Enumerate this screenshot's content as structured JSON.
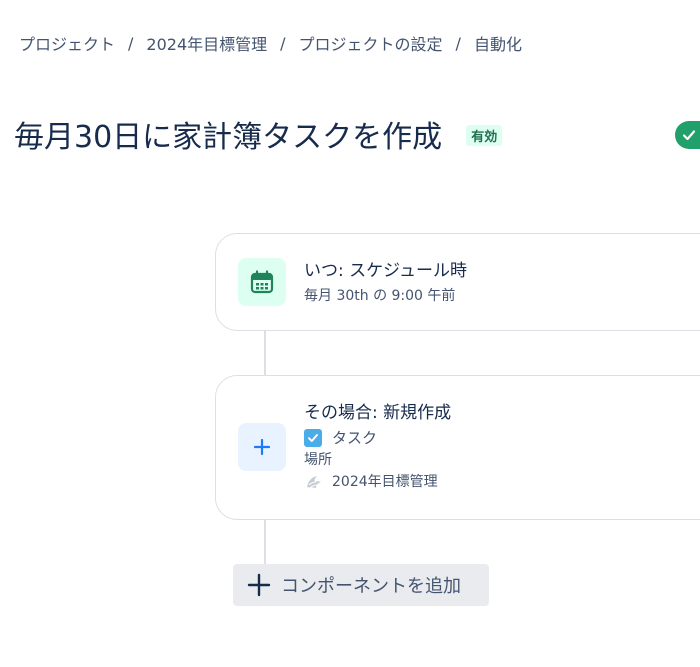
{
  "breadcrumb": {
    "items": [
      "プロジェクト",
      "2024年目標管理",
      "プロジェクトの設定",
      "自動化"
    ],
    "separator": "/"
  },
  "rule": {
    "title": "毎月30日に家計簿タスクを作成",
    "status": "有効",
    "enabled": true
  },
  "trigger": {
    "icon": "calendar-icon",
    "heading": "いつ: スケジュール時",
    "detail": "毎月 30th の 9:00 午前"
  },
  "action": {
    "icon": "plus-icon",
    "heading": "その場合: 新規作成",
    "issue_type": "タスク",
    "location_label": "場所",
    "project": "2024年目標管理"
  },
  "add_component": {
    "label": "コンポーネントを追加"
  },
  "colors": {
    "accent_green": "#22a06b",
    "badge_bg": "#dcfff1",
    "badge_text": "#216e4e",
    "action_blue": "#1d7afc",
    "task_blue": "#4bade8"
  }
}
